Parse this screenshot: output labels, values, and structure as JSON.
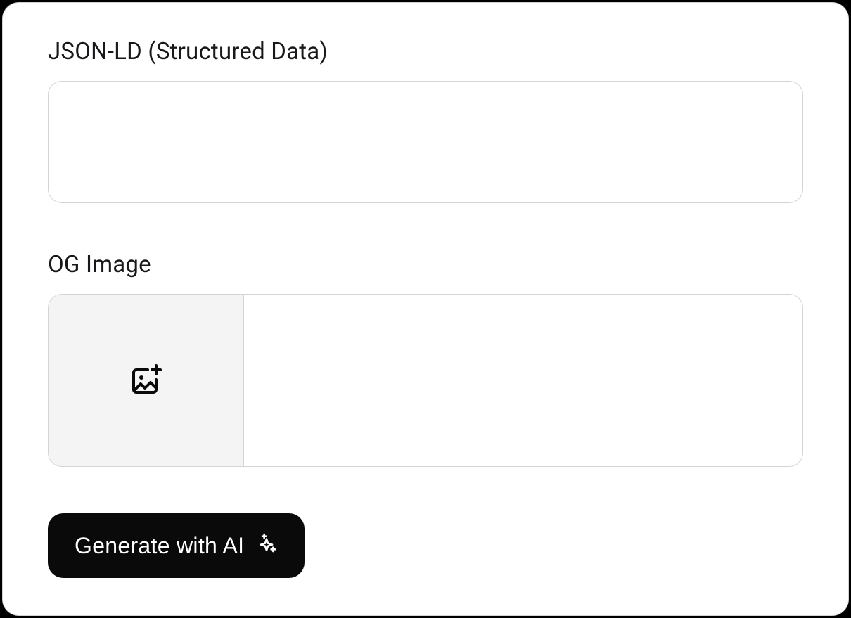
{
  "fields": {
    "jsonld": {
      "label": "JSON-LD (Structured Data)",
      "value": ""
    },
    "ogimage": {
      "label": "OG Image",
      "value": ""
    }
  },
  "buttons": {
    "generate": {
      "label": "Generate with AI"
    }
  }
}
